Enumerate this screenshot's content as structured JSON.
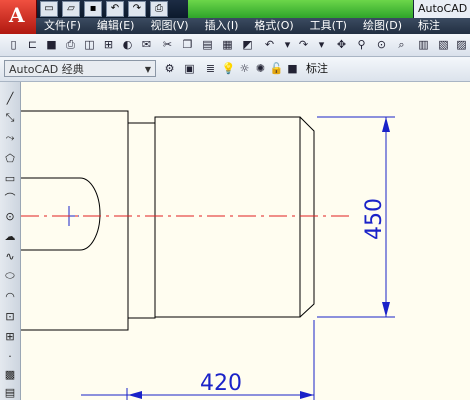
{
  "app": {
    "title": "AutoCAD",
    "logo_letter": "A"
  },
  "quick_access": [
    {
      "icon": "new-file-icon",
      "glyph": "▭"
    },
    {
      "icon": "open-file-icon",
      "glyph": "▱"
    },
    {
      "icon": "save-icon",
      "glyph": "▪"
    },
    {
      "icon": "undo-icon",
      "glyph": "↶"
    },
    {
      "icon": "redo-icon",
      "glyph": "↷"
    },
    {
      "icon": "plot-icon",
      "glyph": "⎙"
    }
  ],
  "menu": [
    "文件(F)",
    "编辑(E)",
    "视图(V)",
    "插入(I)",
    "格式(O)",
    "工具(T)",
    "绘图(D)",
    "标注"
  ],
  "toolbar_standard": [
    "new-icon",
    "open-icon",
    "save-icon",
    "print-icon",
    "plot-preview-icon",
    "publish-icon",
    "3d-dwf-icon",
    "etransmit-icon",
    "cut-icon",
    "copy-icon",
    "paste-icon",
    "match-properties-icon",
    "block-editor-icon",
    "undo-icon",
    "redo-icon",
    "pan-icon",
    "zoom-realtime-icon",
    "zoom-window-icon",
    "zoom-previous-icon",
    "properties-icon"
  ],
  "workspace": {
    "selected": "AutoCAD 经典"
  },
  "layer": {
    "name": "标注"
  },
  "draw_tools": [
    "line-icon",
    "construction-line-icon",
    "polyline-icon",
    "polygon-icon",
    "rectangle-icon",
    "arc-icon",
    "circle-icon",
    "revision-cloud-icon",
    "spline-icon",
    "ellipse-icon",
    "ellipse-arc-icon",
    "insert-block-icon",
    "make-block-icon",
    "point-icon",
    "hatch-icon",
    "gradient-icon"
  ],
  "drawing": {
    "dimension_vertical": "450",
    "dimension_horizontal": "420"
  },
  "colors": {
    "geometry": "#000000",
    "centerline": "#e02020",
    "dimension": "#1a22c8",
    "canvas_bg": "#fffdf0",
    "menubar_bg": "#2d3b50",
    "green_title": "#3fb52f"
  }
}
